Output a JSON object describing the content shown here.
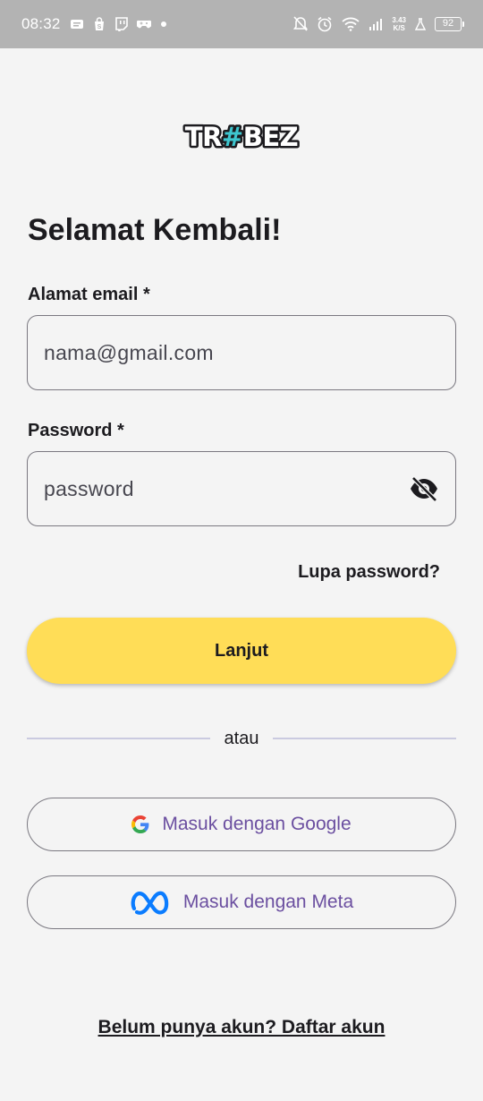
{
  "status_bar": {
    "time": "08:32",
    "network_speed_value": "3.43",
    "network_speed_unit": "K/S",
    "battery": "92"
  },
  "logo": {
    "text": "TR#BEZ"
  },
  "login": {
    "title": "Selamat Kembali!",
    "email_label": "Alamat email *",
    "email_placeholder": "nama@gmail.com",
    "password_label": "Password *",
    "password_placeholder": "password",
    "forgot_password": "Lupa password?",
    "submit_label": "Lanjut",
    "divider_text": "atau",
    "google_label": "Masuk dengan Google",
    "meta_label": "Masuk dengan Meta",
    "signup_link": "Belum punya akun? Daftar akun"
  },
  "colors": {
    "primary_button": "#ffdd57",
    "social_text": "#6b4fa0",
    "background": "#f4f4f4",
    "status_bar": "#b3b3b3"
  }
}
